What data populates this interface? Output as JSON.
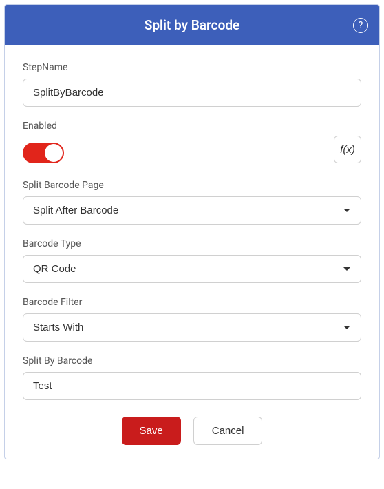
{
  "header": {
    "title": "Split by Barcode",
    "help_symbol": "?"
  },
  "fields": {
    "stepName": {
      "label": "StepName",
      "value": "SplitByBarcode"
    },
    "enabled": {
      "label": "Enabled",
      "on": true
    },
    "fx": {
      "label": "f(x)"
    },
    "splitBarcodePage": {
      "label": "Split Barcode Page",
      "value": "Split After Barcode"
    },
    "barcodeType": {
      "label": "Barcode Type",
      "value": "QR Code"
    },
    "barcodeFilter": {
      "label": "Barcode Filter",
      "value": "Starts With"
    },
    "splitByBarcode": {
      "label": "Split By Barcode",
      "value": "Test"
    }
  },
  "buttons": {
    "save": "Save",
    "cancel": "Cancel"
  }
}
